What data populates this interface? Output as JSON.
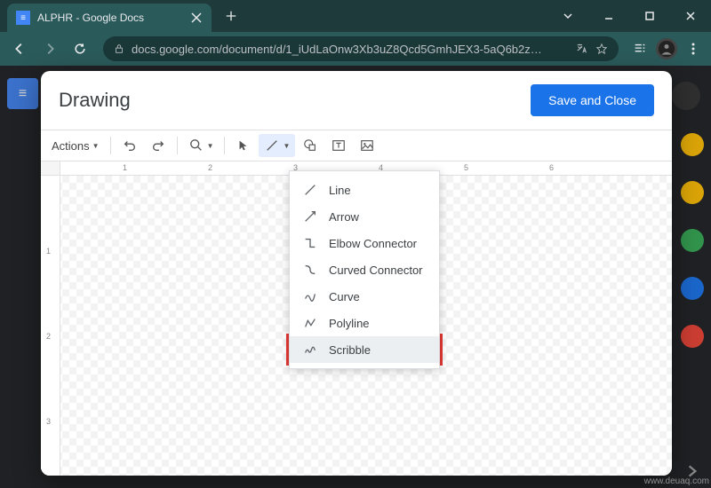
{
  "browser": {
    "tab_title": "ALPHR - Google Docs",
    "url_display": "docs.google.com/document/d/1_iUdLaOnw3Xb3uZ8Qcd5GmhJEX3-5aQ6b2z…",
    "new_tab": "+"
  },
  "modal": {
    "title": "Drawing",
    "save_label": "Save and Close",
    "actions_label": "Actions"
  },
  "ruler": {
    "h": [
      "1",
      "2",
      "3",
      "4",
      "5",
      "6"
    ],
    "v": [
      "1",
      "2",
      "3"
    ]
  },
  "line_menu": {
    "items": [
      {
        "label": "Line",
        "icon": "line"
      },
      {
        "label": "Arrow",
        "icon": "arrow"
      },
      {
        "label": "Elbow Connector",
        "icon": "elbow"
      },
      {
        "label": "Curved Connector",
        "icon": "curved"
      },
      {
        "label": "Curve",
        "icon": "curve"
      },
      {
        "label": "Polyline",
        "icon": "polyline"
      },
      {
        "label": "Scribble",
        "icon": "scribble"
      }
    ],
    "highlighted_index": 6
  },
  "watermark": "www.deuaq.com"
}
